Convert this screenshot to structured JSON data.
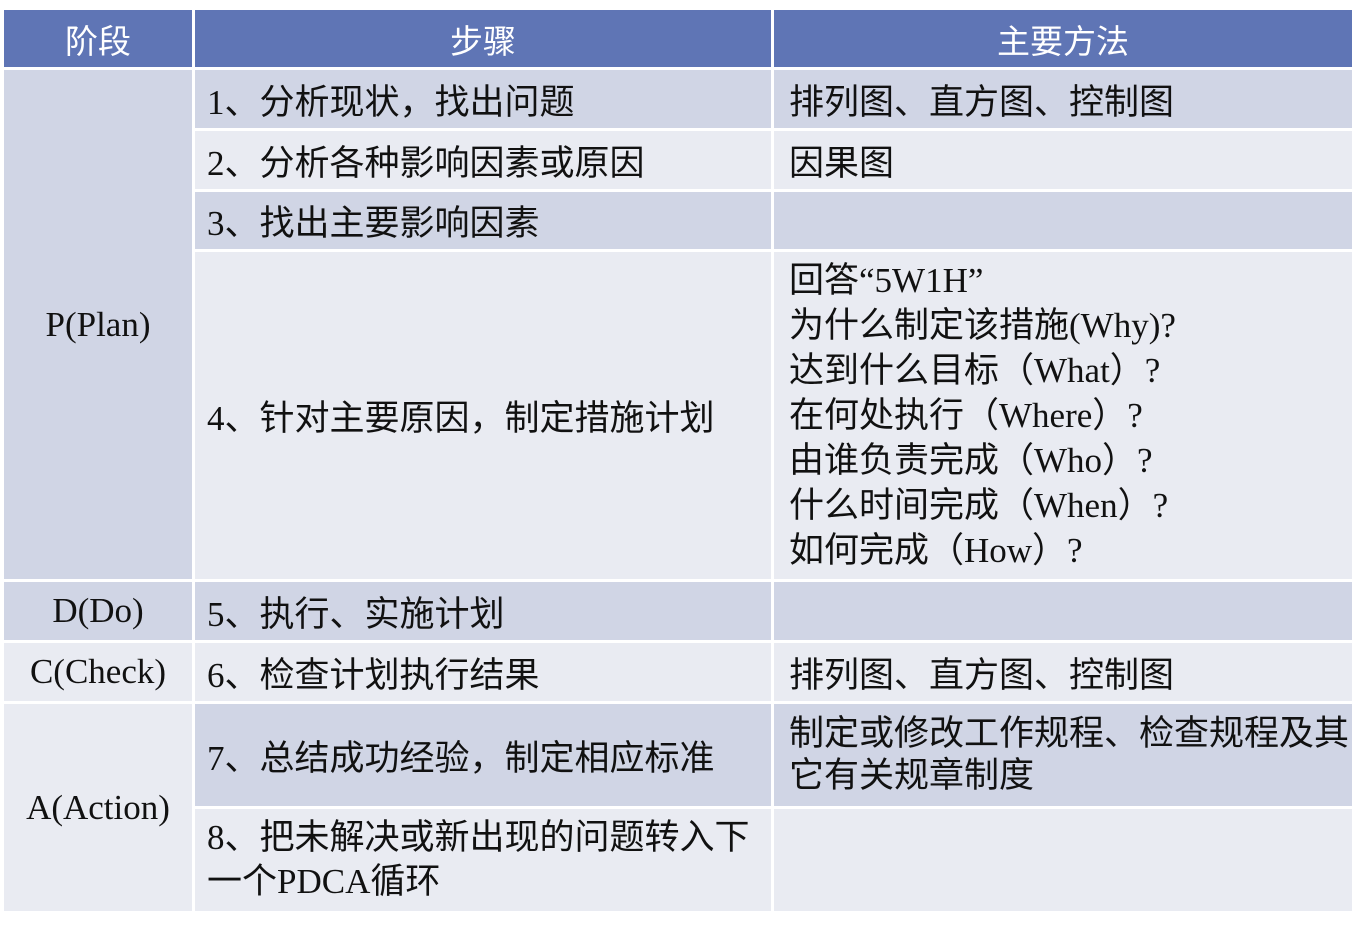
{
  "headers": [
    "阶段",
    "步骤",
    "主要方法"
  ],
  "phases": {
    "plan": "P(Plan)",
    "do": "D(Do)",
    "check": "C(Check)",
    "action": "A(Action)"
  },
  "steps": [
    "1、分析现状，找出问题",
    "2、分析各种影响因素或原因",
    "3、找出主要影响因素",
    "4、针对主要原因，制定措施计划",
    "5、执行、实施计划",
    "6、检查计划执行结果",
    "7、总结成功经验，制定相应标准",
    "8、把未解决或新出现的问题转入下一个PDCA循环"
  ],
  "methods": {
    "m1": "排列图、直方图、控制图",
    "m2": "因果图",
    "m4": [
      "回答“5W1H”",
      "为什么制定该措施(Why)?",
      "达到什么目标（What）?",
      "在何处执行（Where）?",
      "由谁负责完成（Who）?",
      "什么时间完成（When）?",
      "如何完成（How）?"
    ],
    "m6": "排列图、直方图、控制图",
    "m7": "制定或修改工作规程、检查规程及其它有关规章制度"
  }
}
